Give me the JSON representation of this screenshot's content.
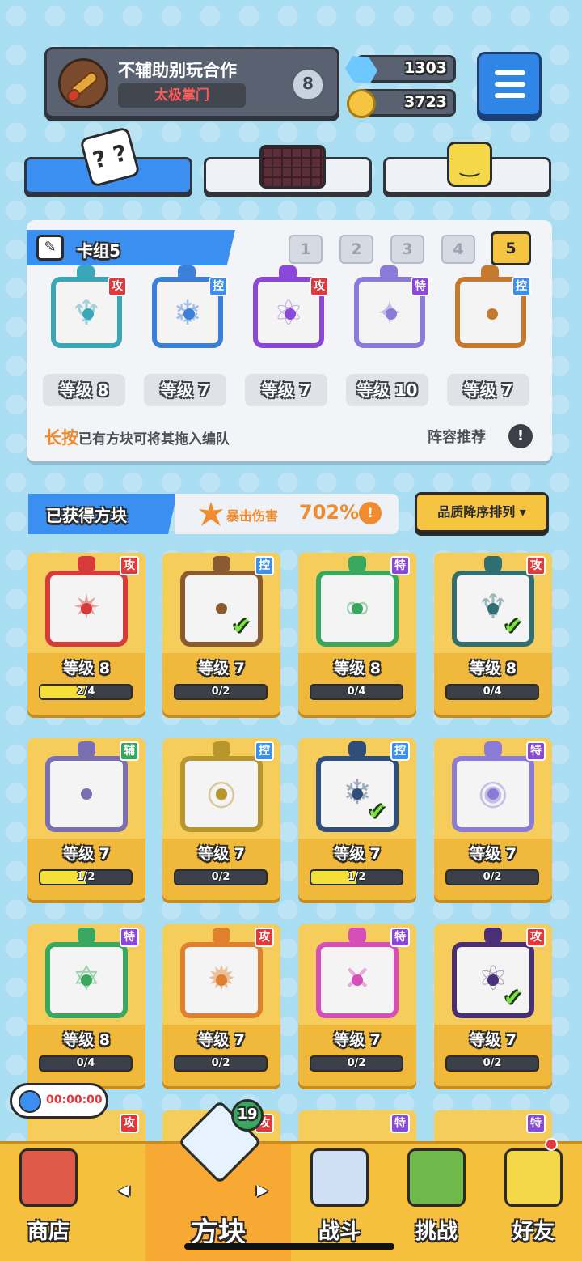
{
  "profile": {
    "player_name": "不辅助别玩合作",
    "title": "太极掌门",
    "rank": "8"
  },
  "currency": {
    "gems": "1303",
    "coins": "3723"
  },
  "tabs": [
    "dice",
    "board",
    "emoji"
  ],
  "deck": {
    "title": "卡组5",
    "deck_numbers": [
      "1",
      "2",
      "3",
      "4",
      "5"
    ],
    "active_deck": "5",
    "dice": [
      {
        "tag": "攻",
        "level": "等级 8",
        "color": "#3aa7b8",
        "glyph": "♆",
        "tag_class": "tag-red"
      },
      {
        "tag": "控",
        "level": "等级 7",
        "color": "#3a7fd8",
        "glyph": "❄",
        "tag_class": "tag-blue"
      },
      {
        "tag": "攻",
        "level": "等级 7",
        "color": "#8a47d9",
        "glyph": "⚛",
        "tag_class": "tag-red"
      },
      {
        "tag": "特",
        "level": "等级 10",
        "color": "#8a7bd9",
        "glyph": "✦",
        "tag_class": "tag-purple"
      },
      {
        "tag": "控",
        "level": "等级 7",
        "color": "#c77a2e",
        "glyph": "",
        "tag_class": "tag-blue"
      }
    ],
    "hint_emphasis": "长按",
    "hint_rest": "已有方块可将其拖入编队",
    "recommend": "阵容推荐"
  },
  "owned": {
    "title": "已获得方块",
    "crit_label": "暴击伤害",
    "crit_value": "702%",
    "sort_label": "品质降序排列 ▾",
    "cards": [
      {
        "tag": "攻",
        "tag_class": "tag-red",
        "color": "#d63a3a",
        "glyph": "✷",
        "level": "等级 8",
        "progress": "2/4",
        "fill": 0.5,
        "equipped": false
      },
      {
        "tag": "控",
        "tag_class": "tag-blue",
        "color": "#8a5a30",
        "glyph": "",
        "level": "等级 7",
        "progress": "0/2",
        "fill": 0,
        "equipped": true
      },
      {
        "tag": "特",
        "tag_class": "tag-purple",
        "color": "#3aa760",
        "glyph": "∞",
        "level": "等级 8",
        "progress": "0/4",
        "fill": 0,
        "equipped": false
      },
      {
        "tag": "攻",
        "tag_class": "tag-red",
        "color": "#2f6e73",
        "glyph": "♆",
        "level": "等级 8",
        "progress": "0/4",
        "fill": 0,
        "equipped": true
      },
      {
        "tag": "辅",
        "tag_class": "tag-green",
        "color": "#7a6fb0",
        "glyph": "",
        "level": "等级 7",
        "progress": "1/2",
        "fill": 0.5,
        "equipped": false
      },
      {
        "tag": "控",
        "tag_class": "tag-blue",
        "color": "#b8962e",
        "glyph": "◎",
        "level": "等级 7",
        "progress": "0/2",
        "fill": 0,
        "equipped": false
      },
      {
        "tag": "控",
        "tag_class": "tag-blue",
        "color": "#2f4f78",
        "glyph": "❄",
        "level": "等级 7",
        "progress": "1/2",
        "fill": 0.5,
        "equipped": true
      },
      {
        "tag": "特",
        "tag_class": "tag-purple",
        "color": "#8a7bd9",
        "glyph": "◉",
        "level": "等级 7",
        "progress": "0/2",
        "fill": 0,
        "equipped": false
      },
      {
        "tag": "特",
        "tag_class": "tag-purple",
        "color": "#3aa760",
        "glyph": "✡",
        "level": "等级 8",
        "progress": "0/4",
        "fill": 0,
        "equipped": false
      },
      {
        "tag": "攻",
        "tag_class": "tag-red",
        "color": "#e0802e",
        "glyph": "✹",
        "level": "等级 7",
        "progress": "0/2",
        "fill": 0,
        "equipped": false
      },
      {
        "tag": "特",
        "tag_class": "tag-purple",
        "color": "#d64fb8",
        "glyph": "✕",
        "level": "等级 7",
        "progress": "0/2",
        "fill": 0,
        "equipped": false
      },
      {
        "tag": "攻",
        "tag_class": "tag-red",
        "color": "#4a2f78",
        "glyph": "⚛",
        "level": "等级 7",
        "progress": "0/2",
        "fill": 0,
        "equipped": true
      }
    ],
    "partial_row_tags": [
      "攻",
      "攻",
      "特",
      "特"
    ]
  },
  "timer": "00:00:00",
  "dice_badge": "19",
  "nav": {
    "shop": "商店",
    "dice": "方块",
    "battle": "战斗",
    "challenge": "挑战",
    "friends": "好友"
  }
}
